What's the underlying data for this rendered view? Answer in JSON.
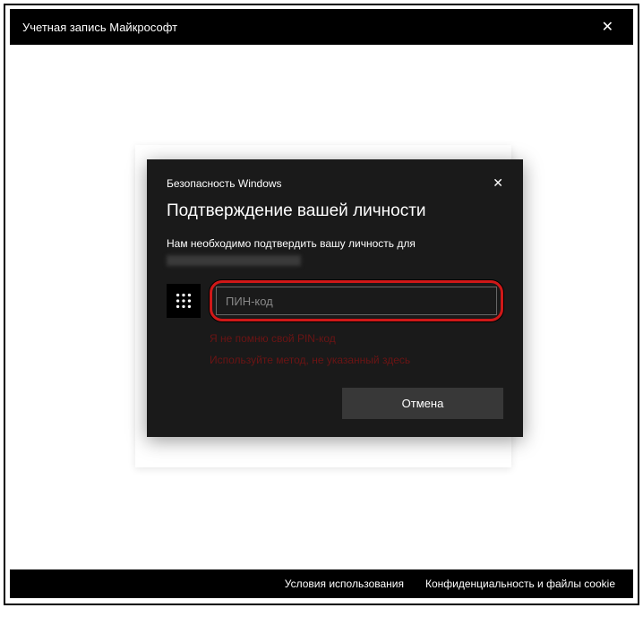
{
  "window": {
    "title": "Учетная запись Майкрософт"
  },
  "security": {
    "header": "Безопасность Windows",
    "title": "Подтверждение вашей личности",
    "subtitle": "Нам необходимо подтвердить вашу личность для",
    "pin_placeholder": "ПИН-код",
    "forgot_pin": "Я не помню свой PIN-код",
    "other_method": "Используйте метод, не указанный здесь",
    "cancel": "Отмена"
  },
  "footer": {
    "terms": "Условия использования",
    "privacy": "Конфиденциальность и файлы cookie"
  }
}
